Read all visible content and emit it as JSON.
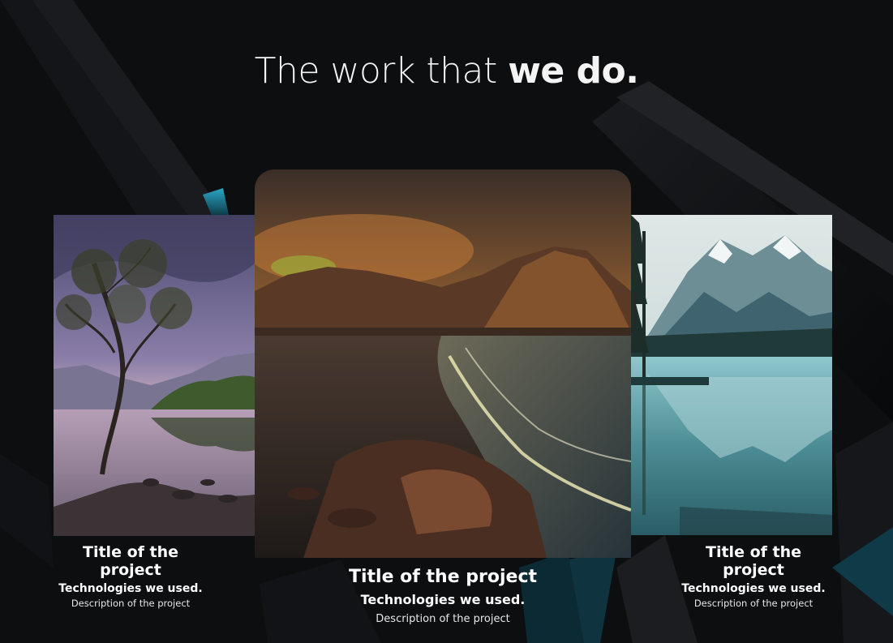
{
  "heading": {
    "light": "The work that ",
    "bold": "we do."
  },
  "projects": [
    {
      "title": "Title of the project",
      "technologies": "Technologies we used.",
      "description": "Description of the project",
      "image": "lone-tree-lake-dusk"
    },
    {
      "title": "Title of the project",
      "technologies": "Technologies we used.",
      "description": "Description of the project",
      "image": "mountain-beach-sunset"
    },
    {
      "title": "Title of the project",
      "technologies": "Technologies we used.",
      "description": "Description of the project",
      "image": "alpine-lake-reflection"
    }
  ],
  "colors": {
    "background": "#0d0e10",
    "accent": "#1f7f96",
    "text": "#ffffff"
  }
}
